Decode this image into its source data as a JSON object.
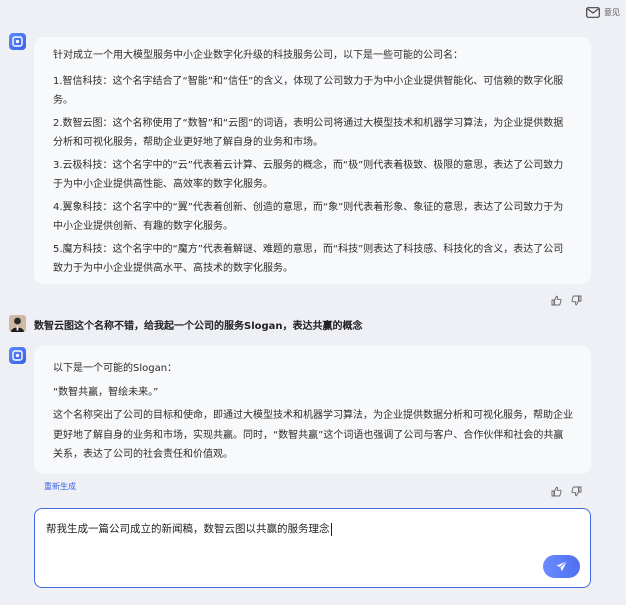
{
  "topbar": {
    "feedback_label": "意见"
  },
  "conversation": {
    "bot_reply_1": {
      "paragraphs": [
        "针对成立一个用大模型服务中小企业数字化升级的科技服务公司，以下是一些可能的公司名：",
        "1.智信科技：这个名字结合了“智能”和“信任”的含义，体现了公司致力于为中小企业提供智能化、可信赖的数字化服务。",
        "2.数智云图：这个名称使用了“数智”和“云图”的词语，表明公司将通过大模型技术和机器学习算法，为企业提供数据分析和可视化服务，帮助企业更好地了解自身的业务和市场。",
        "3.云极科技：这个名字中的“云”代表着云计算、云服务的概念，而“极”则代表着极致、极限的意思，表达了公司致力于为中小企业提供高性能、高效率的数字化服务。",
        "4.翼象科技：这个名字中的“翼”代表着创新、创造的意思，而“象”则代表着形象、象征的意思，表达了公司致力于为中小企业提供创新、有趣的数字化服务。",
        "5.魔方科技：这个名字中的“魔方”代表着解谜、难题的意思，而“科技”则表达了科技感、科技化的含义，表达了公司致力于为中小企业提供高水平、高技术的数字化服务。"
      ]
    },
    "user_message": "数智云图这个名称不错，给我起一个公司的服务Slogan，表达共赢的概念",
    "bot_reply_2": {
      "paragraphs": [
        "以下是一个可能的Slogan：",
        "“数智共赢，智绘未来。”",
        "这个名称突出了公司的目标和使命，即通过大模型技术和机器学习算法，为企业提供数据分析和可视化服务，帮助企业更好地了解自身的业务和市场，实现共赢。同时，“数智共赢”这个词语也强调了公司与客户、合作伙伴和社会的共赢关系，表达了公司的社会责任和价值观。"
      ],
      "regenerate_label": "重新生成"
    }
  },
  "input": {
    "value": "帮我生成一篇公司成立的新闻稿，数智云图以共赢的服务理念"
  },
  "colors": {
    "accent": "#3f6be8",
    "background": "#eef0f5",
    "bubble": "#f8f9fb"
  },
  "icons": [
    "mail-icon",
    "bot-avatar-icon",
    "thumbs-up-icon",
    "thumbs-down-icon",
    "send-icon"
  ]
}
